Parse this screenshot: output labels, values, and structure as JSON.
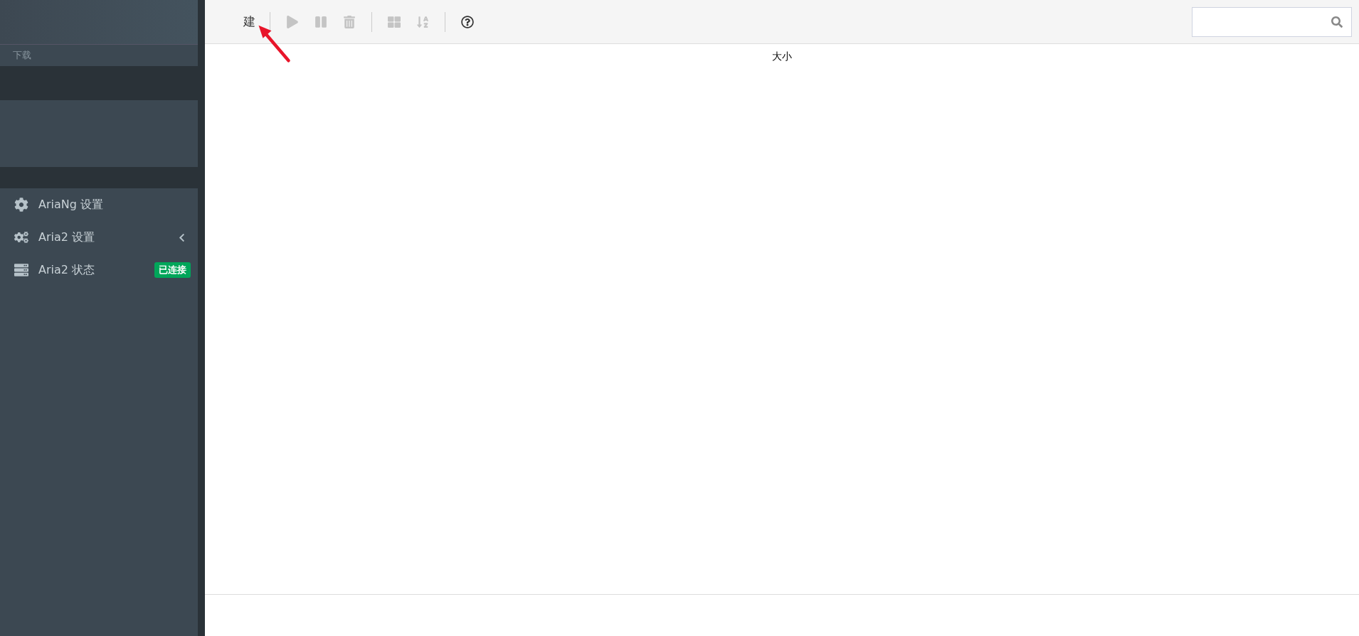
{
  "sidebar": {
    "section_title": "下载",
    "items": [
      {
        "kind": "gear",
        "label": "AriaNg 设置"
      },
      {
        "kind": "gears",
        "label": "Aria2 设置",
        "expanded": false
      },
      {
        "kind": "server",
        "label": "Aria2 状态",
        "badge": "已连接"
      }
    ]
  },
  "toolbar": {
    "new_button": "建",
    "tools": [
      {
        "kind": "start",
        "disabled": true
      },
      {
        "kind": "pause",
        "disabled": true
      },
      {
        "kind": "delete",
        "disabled": true
      },
      {
        "kind": "display",
        "disabled": true
      },
      {
        "kind": "sort",
        "disabled": true
      },
      {
        "kind": "help",
        "disabled": false
      }
    ]
  },
  "table": {
    "columns": [
      "大小"
    ]
  }
}
